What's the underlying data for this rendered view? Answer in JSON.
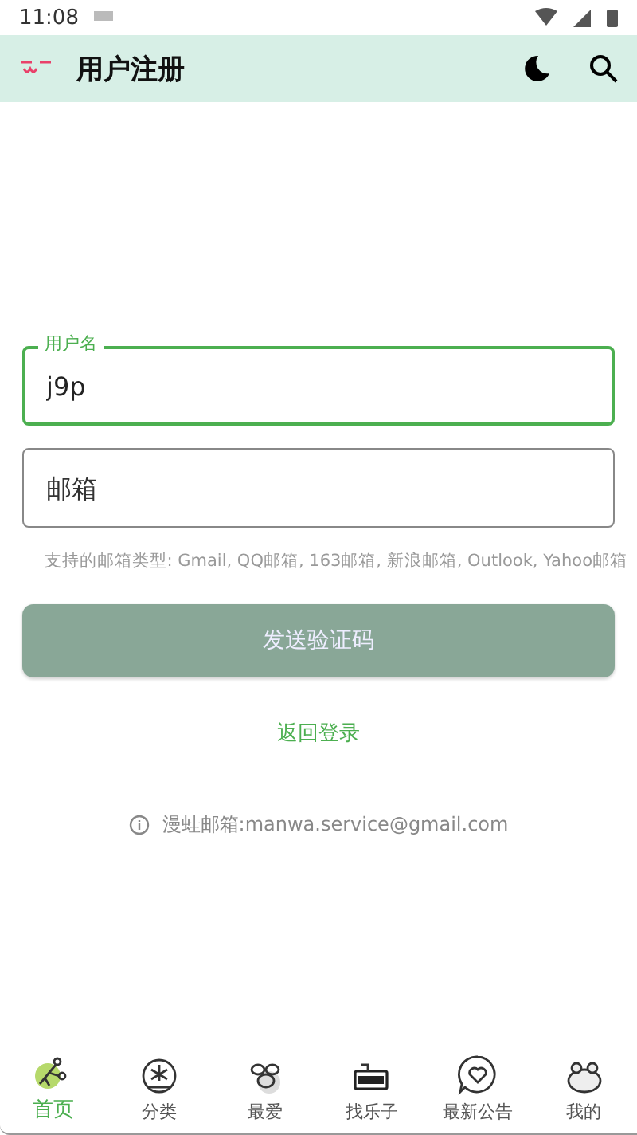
{
  "status_bar": {
    "time": "11:08"
  },
  "app_bar": {
    "title": "用户注册"
  },
  "form": {
    "username": {
      "label": "用户名",
      "value": "j9p",
      "focused": true
    },
    "email": {
      "placeholder": "邮箱",
      "focused": false
    },
    "hint": "支持的邮箱类型: Gmail, QQ邮箱, 163邮箱, 新浪邮箱, Outlook, Yahoo邮箱",
    "send_button": {
      "label": "发送验证码",
      "disabled": true
    },
    "back_link": "返回登录",
    "contact": "漫蛙邮箱:manwa.service@gmail.com"
  },
  "bottom_nav": [
    {
      "label": "首页",
      "kind": "home",
      "selected": true
    },
    {
      "label": "分类",
      "kind": "category",
      "selected": false
    },
    {
      "label": "最爱",
      "kind": "favorite",
      "selected": false
    },
    {
      "label": "找乐子",
      "kind": "game",
      "selected": false
    },
    {
      "label": "最新公告",
      "kind": "notice",
      "selected": false
    },
    {
      "label": "我的",
      "kind": "mine",
      "selected": false
    }
  ]
}
